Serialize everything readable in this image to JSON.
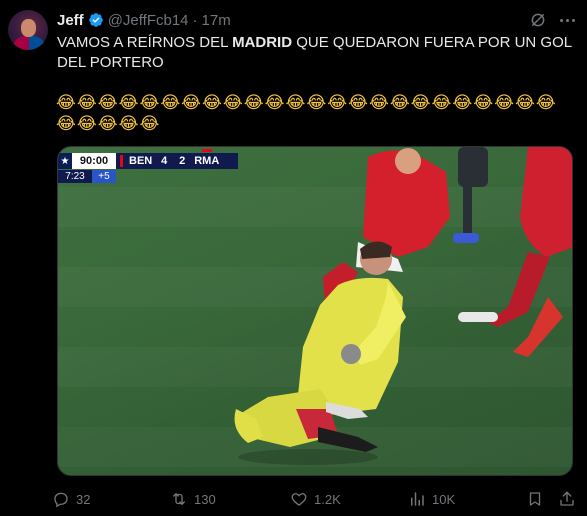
{
  "author": {
    "display_name": "Jeff",
    "handle": "@JeffFcb14",
    "separator": "·",
    "time": "17m",
    "verified": true
  },
  "tweet": {
    "text_before": "VAMOS A REÍRNOS DEL ",
    "text_bold": "MADRID",
    "text_after": " QUE QUEDARON FUERA POR UN GOL DEL PORTERO",
    "emojis": "😂😂😂😂😂😂😂😂😂😂😂😂😂😂😂😂😂😂😂😂😂😂😂😂😂😂😂😂😂"
  },
  "media": {
    "scorebug": {
      "clock": "90:00",
      "home_team": "BEN",
      "home_score": "4",
      "away_score": "2",
      "away_team": "RMA",
      "added_time": "7:23",
      "extra": "+5"
    }
  },
  "actions": {
    "replies": "32",
    "reposts": "130",
    "likes": "1.2K",
    "views": "10K"
  },
  "colors": {
    "background": "#000000",
    "text": "#e7e9ea",
    "muted": "#71767b",
    "verified": "#1d9bf0",
    "pitch": "#3a6a3b"
  },
  "icons": [
    "verified-badge-icon",
    "grok-icon",
    "more-icon",
    "reply-icon",
    "repost-icon",
    "like-icon",
    "views-icon",
    "bookmark-icon",
    "share-icon"
  ]
}
